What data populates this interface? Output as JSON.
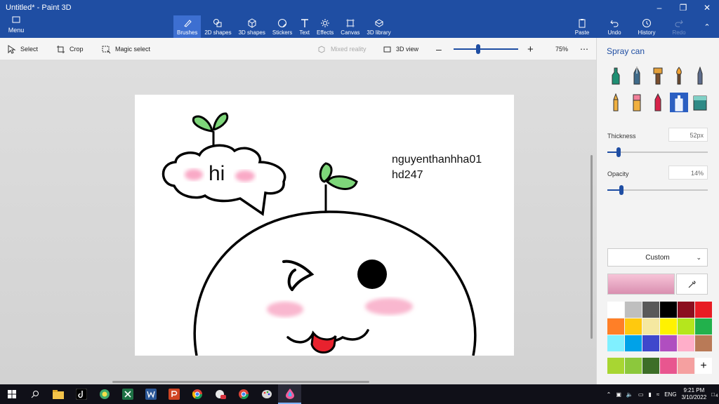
{
  "window": {
    "title": "Untitled* - Paint 3D",
    "menu_label": "Menu"
  },
  "ribbon": {
    "tools": [
      {
        "label": "Brushes",
        "icon": "brush-icon",
        "active": true
      },
      {
        "label": "2D shapes",
        "icon": "2d-shapes-icon"
      },
      {
        "label": "3D shapes",
        "icon": "3d-shapes-icon"
      },
      {
        "label": "Stickers",
        "icon": "stickers-icon"
      },
      {
        "label": "Text",
        "icon": "text-icon"
      },
      {
        "label": "Effects",
        "icon": "effects-icon"
      },
      {
        "label": "Canvas",
        "icon": "canvas-icon"
      },
      {
        "label": "3D library",
        "icon": "3d-library-icon"
      }
    ],
    "right_tools": [
      {
        "label": "Paste",
        "icon": "paste-icon"
      },
      {
        "label": "Undo",
        "icon": "undo-icon"
      },
      {
        "label": "History",
        "icon": "history-icon"
      },
      {
        "label": "Redo",
        "icon": "redo-icon",
        "disabled": true
      }
    ]
  },
  "toolbar2": {
    "select": "Select",
    "crop": "Crop",
    "magic_select": "Magic select",
    "mixed_reality": "Mixed reality",
    "view_3d": "3D view",
    "zoom_value": "75%",
    "zoom_fraction": 0.38
  },
  "canvas": {
    "speech_text": "hi",
    "text_lines": "nguyenthanhha01\nhd247"
  },
  "panel": {
    "title": "Spray can",
    "thickness_label": "Thickness",
    "thickness_value": "52px",
    "thickness_fraction": 0.11,
    "opacity_label": "Opacity",
    "opacity_value": "14%",
    "opacity_fraction": 0.14,
    "color_mode": "Custom",
    "selected_color": "#f0b8cf",
    "palette": [
      "#ffffff",
      "#bfbfbf",
      "#595959",
      "#000000",
      "#8b0f1f",
      "#e81c24",
      "#ff7f27",
      "#ffc90e",
      "#f5e8a0",
      "#fff200",
      "#b5e61d",
      "#22b14c",
      "#80f0ff",
      "#00a2e8",
      "#3f48cc",
      "#b04ec0",
      "#ffaec9",
      "#b97a57"
    ],
    "custom_colors": [
      "#a8d632",
      "#8cc83c",
      "#3d6e28",
      "#e8568f",
      "#f5a0a0"
    ]
  },
  "taskbar": {
    "time": "9:21 PM",
    "date": "3/10/2022",
    "lang": "ENG",
    "notification_count": "4"
  }
}
